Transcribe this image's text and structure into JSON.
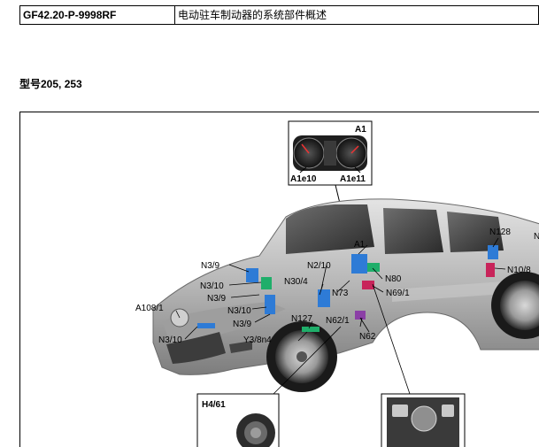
{
  "header": {
    "doc_code": "GF42.20-P-9998RF",
    "doc_title": "电动驻车制动器的系统部件概述"
  },
  "model_line": "型号205, 253",
  "figure": {
    "labels": {
      "a1_box": "A1",
      "a1e10": "A1e10",
      "a1e11": "A1e11",
      "a1": "A1",
      "n2_10": "N2/10",
      "n3_9_a": "N3/9",
      "n3_10_a": "N3/10",
      "n3_9_b": "N3/9",
      "n3_10_b": "N3/10",
      "n3_9_c": "N3/9",
      "n3_10_c": "N3/10",
      "a108_1": "A108/1",
      "n30_4": "N30/4",
      "n73": "N73",
      "n80": "N80",
      "n69_1": "N69/1",
      "n127": "N127",
      "n62_1": "N62/1",
      "n62": "N62",
      "y3_8n4": "Y3/8n4",
      "n128": "N128",
      "n10_8": "N10/8",
      "n_cut": "N",
      "h4_61": "H4/61"
    }
  }
}
